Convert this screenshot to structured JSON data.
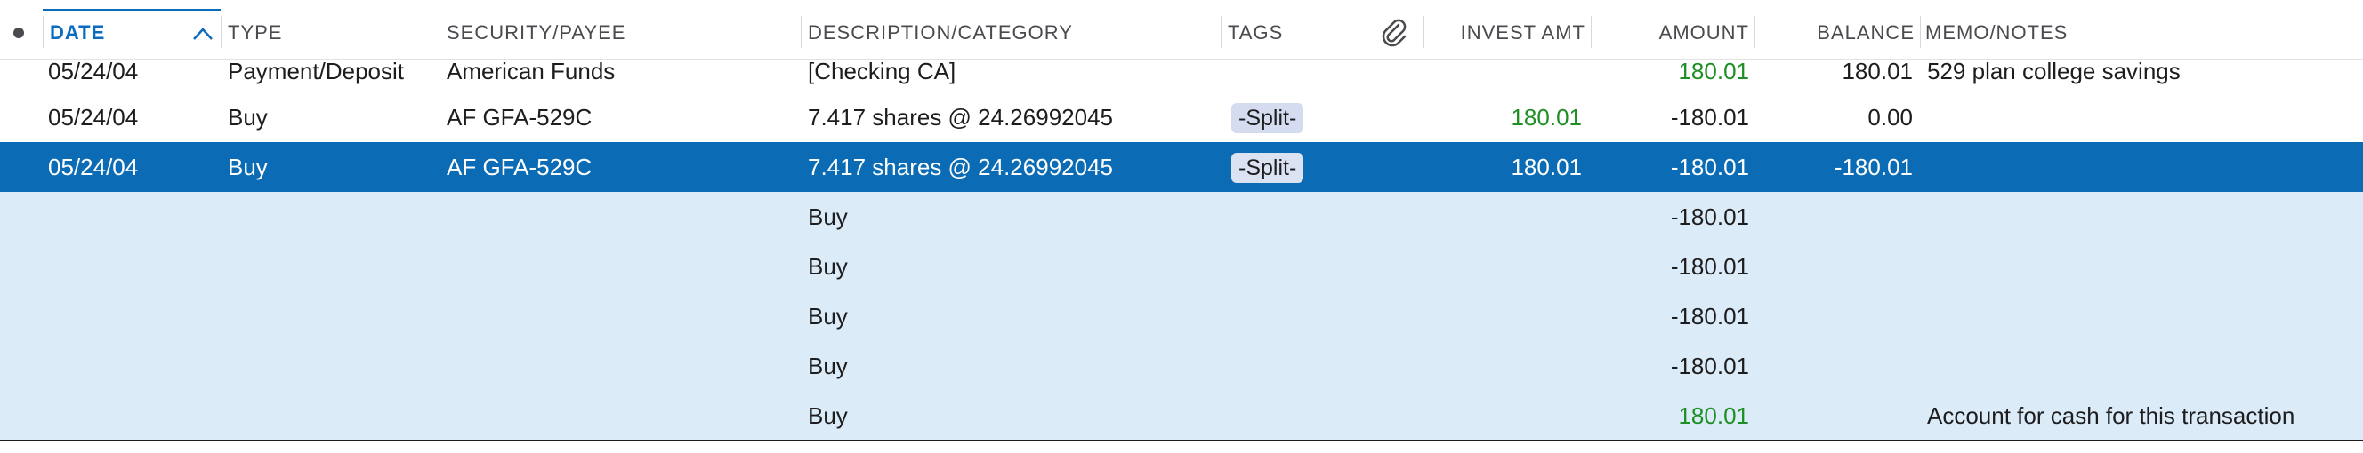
{
  "header": {
    "date": "DATE",
    "type": "TYPE",
    "security_payee": "SECURITY/PAYEE",
    "description_category": "DESCRIPTION/CATEGORY",
    "tags": "TAGS",
    "invest_amt": "INVEST AMT",
    "amount": "AMOUNT",
    "balance": "BALANCE",
    "memo_notes": "MEMO/NOTES",
    "sort_direction": "ascending",
    "status_icon": "status-dot-icon",
    "attachment_icon": "paperclip-icon",
    "sort_icon": "chevron-up-icon"
  },
  "rows": [
    {
      "date": "05/24/04",
      "type": "Payment/Deposit",
      "payee": "American Funds",
      "description": "[Checking CA]",
      "tags": "",
      "invest_amt": "",
      "amount": "180.01",
      "balance": "180.01",
      "memo": "529 plan college savings"
    },
    {
      "date": "05/24/04",
      "type": "Buy",
      "payee": "AF GFA-529C",
      "description": "7.417 shares @ 24.26992045",
      "tags": "-Split-",
      "invest_amt": "180.01",
      "amount": "-180.01",
      "balance": "0.00",
      "memo": ""
    },
    {
      "date": "05/24/04",
      "type": "Buy",
      "payee": "AF GFA-529C",
      "description": "7.417 shares @ 24.26992045",
      "tags": "-Split-",
      "invest_amt": "180.01",
      "amount": "-180.01",
      "balance": "-180.01",
      "memo": ""
    }
  ],
  "split_lines": [
    {
      "description": "Buy",
      "amount": "-180.01",
      "memo": ""
    },
    {
      "description": "Buy",
      "amount": "-180.01",
      "memo": ""
    },
    {
      "description": "Buy",
      "amount": "-180.01",
      "memo": ""
    },
    {
      "description": "Buy",
      "amount": "-180.01",
      "memo": ""
    },
    {
      "description": "Buy",
      "amount": "180.01",
      "memo": "Account for cash for this transaction"
    }
  ],
  "colors": {
    "selection": "#0b6cb5",
    "split_background": "#dbecf8",
    "positive_amount": "#1e8f24",
    "sort_accent": "#0b6bbd"
  }
}
